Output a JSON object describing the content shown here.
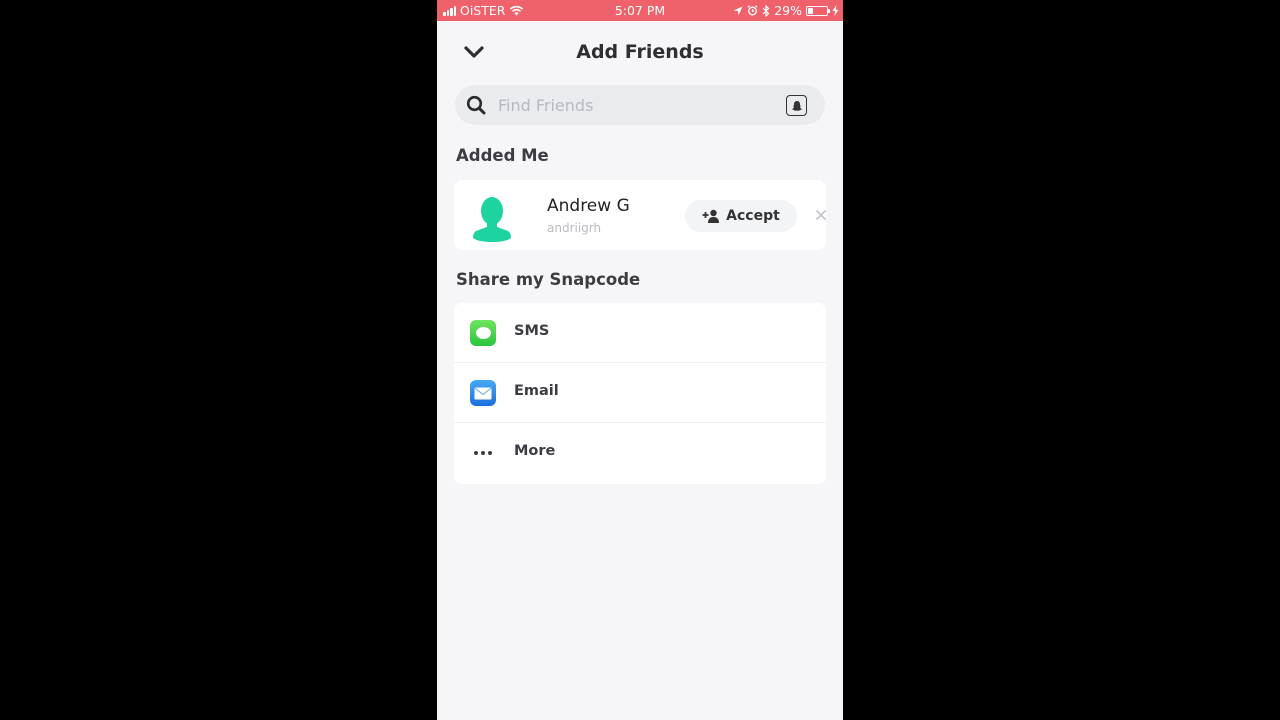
{
  "status_bar": {
    "carrier": "OiSTER",
    "time": "5:07 PM",
    "battery_percent": "29%",
    "battery_level": 0.29,
    "background_color": "#f0626b"
  },
  "header": {
    "title": "Add Friends",
    "back_icon": "chevron-down-icon"
  },
  "search": {
    "placeholder": "Find Friends",
    "value": "",
    "icons": [
      "search-icon",
      "snapcode-ghost-icon"
    ]
  },
  "added_me": {
    "section_title": "Added Me",
    "requests": [
      {
        "display_name": "Andrew G",
        "username": "andriigrh",
        "accept_label": "Accept",
        "avatar_color": "#1dd3a0"
      }
    ]
  },
  "share": {
    "section_title": "Share my Snapcode",
    "options": [
      {
        "label": "SMS",
        "icon": "messages-icon"
      },
      {
        "label": "Email",
        "icon": "mail-icon"
      },
      {
        "label": "More",
        "icon": "more-dots-icon"
      }
    ]
  }
}
